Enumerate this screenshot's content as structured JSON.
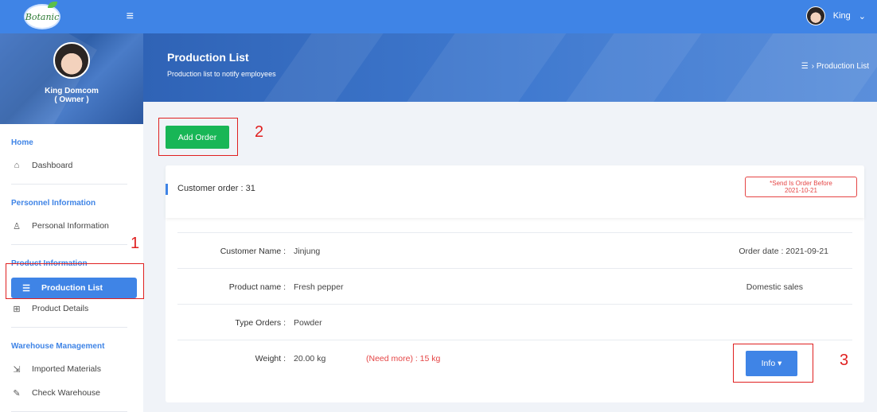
{
  "app": {
    "logo_text": "Botanic",
    "menu_icon": "hamburger-icon"
  },
  "profile": {
    "name": "King Domcom",
    "role": "( Owner )"
  },
  "sidebar": {
    "sections": [
      {
        "title": "Home",
        "items": [
          {
            "label": "Dashboard",
            "icon": "home-icon"
          }
        ]
      },
      {
        "title": "Personnel Information",
        "items": [
          {
            "label": "Personal Information",
            "icon": "user-icon"
          }
        ]
      },
      {
        "title": "Product Information",
        "items": [
          {
            "label": "Production List",
            "icon": "list-icon",
            "active": true
          },
          {
            "label": "Product Details",
            "icon": "grid-icon"
          }
        ]
      },
      {
        "title": "Warehouse Management",
        "items": [
          {
            "label": "Imported Materials",
            "icon": "import-icon"
          },
          {
            "label": "Check Warehouse",
            "icon": "edit-icon"
          }
        ]
      }
    ]
  },
  "topbar": {
    "username": "King",
    "caret": "⌄"
  },
  "banner": {
    "title": "Production List",
    "subtitle": "Production list to notify employees",
    "breadcrumb": "› Production List"
  },
  "actions": {
    "add_order": "Add Order"
  },
  "annotations": {
    "n1": "1",
    "n2": "2",
    "n3": "3"
  },
  "order": {
    "heading": "Customer order : 31",
    "send_notice_line1": "*Send Is Order Before",
    "send_notice_line2": "2021-10-21",
    "customer_label": "Customer Name :",
    "customer_value": "Jinjung",
    "order_date": "Order date : 2021-09-21",
    "product_label": "Product name :",
    "product_value": "Fresh pepper",
    "sales_type": "Domestic sales",
    "type_label": "Type Orders :",
    "type_value": "Powder",
    "weight_label": "Weight :",
    "weight_value": "20.00 kg",
    "need_more": "(Need more) : 15 kg",
    "info_button": "Info ▾"
  },
  "colors": {
    "primary": "#3f84e6",
    "success": "#18b656",
    "danger": "#e54545",
    "annotation": "#e02020"
  }
}
